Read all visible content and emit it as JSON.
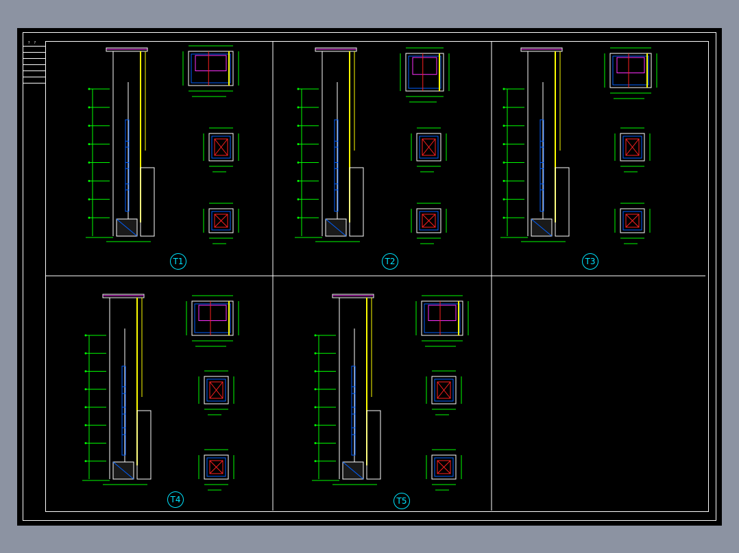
{
  "title_block": {
    "header_a": "?",
    "header_b": "?"
  },
  "drawings": [
    {
      "tag": "T1"
    },
    {
      "tag": "T2"
    },
    {
      "tag": "T3"
    },
    {
      "tag": "T4"
    },
    {
      "tag": "T5"
    }
  ],
  "colors": {
    "background": "#8c93a2",
    "sheet": "#000000",
    "frame": "#ffffff",
    "dimension": "#00ff00",
    "wall": "#ffff00",
    "section": "#0060ff",
    "accent_red": "#ff2020",
    "accent_magenta": "#ff30ff",
    "tag": "#00e5ff"
  }
}
